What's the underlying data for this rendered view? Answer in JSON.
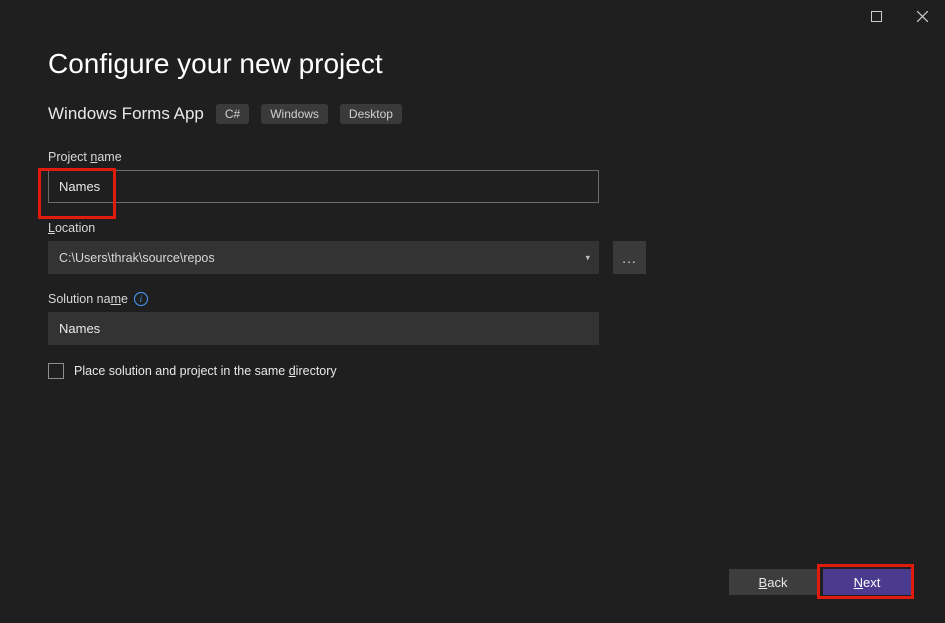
{
  "titlebar": {
    "maximize": "▢",
    "close": "✕"
  },
  "page": {
    "title": "Configure your new project",
    "template_name": "Windows Forms App",
    "badges": [
      "C#",
      "Windows",
      "Desktop"
    ]
  },
  "fields": {
    "project_name": {
      "label_pre": "Project ",
      "label_u": "n",
      "label_post": "ame",
      "value": "Names"
    },
    "location": {
      "label_u": "L",
      "label_post": "ocation",
      "value": "C:\\Users\\thrak\\source\\repos",
      "browse": "..."
    },
    "solution_name": {
      "label_pre": "Solution na",
      "label_u": "m",
      "label_post": "e",
      "value": "Names"
    },
    "checkbox": {
      "label_pre": "Place solution and project in the same ",
      "label_u": "d",
      "label_post": "irectory"
    }
  },
  "footer": {
    "back": {
      "u": "B",
      "rest": "ack"
    },
    "next": {
      "u": "N",
      "rest": "ext"
    }
  }
}
